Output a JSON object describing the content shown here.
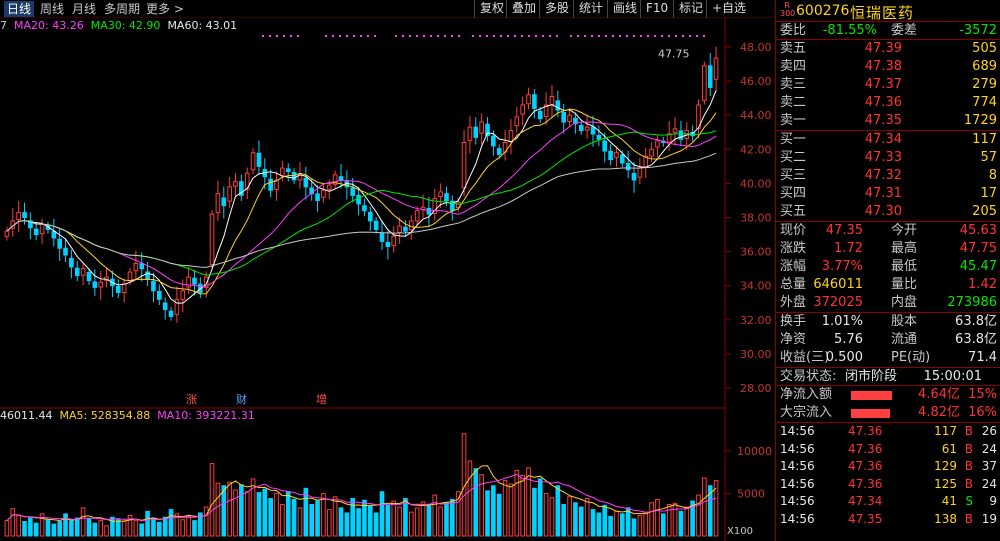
{
  "toolbar": {
    "periods": [
      "日线",
      "周线",
      "月线",
      "多周期",
      "更多 >"
    ],
    "buttons": [
      "复权",
      "叠加",
      "多股",
      "统计",
      "画线",
      "F10",
      "标记",
      "+自选"
    ]
  },
  "ma_line": {
    "cut": "7",
    "ma20": "MA20: 43.26",
    "ma30": "MA30: 42.90",
    "ma60": "MA60: 43.01"
  },
  "vol_line": {
    "vol": "46011.44",
    "ma5": "MA5: 528354.88",
    "ma10": "MA10: 393221.31"
  },
  "chart_data": {
    "type": "candlestick",
    "y_ticks": [
      "48.00",
      "46.00",
      "44.00",
      "42.00",
      "40.00",
      "38.00",
      "36.00",
      "34.00",
      "32.00",
      "30.00",
      "28.00"
    ],
    "ylim": [
      27,
      49
    ],
    "high_label": "47.75",
    "events": [
      "涨",
      "财",
      "增"
    ],
    "vol_ticks": [
      "10000",
      "5000"
    ],
    "vol_unit": "X100",
    "colors": {
      "up": "#ff3c3c",
      "down": "#00d2ff",
      "ma5": "#ffffff",
      "ma10": "#ffd21e",
      "ma20": "#ff3cff",
      "ma30": "#00e600",
      "ma60": "#c8c8c8"
    },
    "closes": [
      37.2,
      37.8,
      38.3,
      38.0,
      37.4,
      37.0,
      37.6,
      37.3,
      36.8,
      36.2,
      35.8,
      35.1,
      34.6,
      35.0,
      34.3,
      33.9,
      34.2,
      34.5,
      34.0,
      33.6,
      34.1,
      34.8,
      35.3,
      35.0,
      34.4,
      33.7,
      33.2,
      32.6,
      32.2,
      33.2,
      33.7,
      34.5,
      34.1,
      33.6,
      34.5,
      38.2,
      39.4,
      38.7,
      39.8,
      40.1,
      39.3,
      40.6,
      41.8,
      41.0,
      40.4,
      39.6,
      40.2,
      40.9,
      40.7,
      40.2,
      40.5,
      39.8,
      39.4,
      39.0,
      39.6,
      39.9,
      40.5,
      40.2,
      39.8,
      39.3,
      38.8,
      38.4,
      37.8,
      37.3,
      36.6,
      36.3,
      36.9,
      37.5,
      37.2,
      37.8,
      38.4,
      38.6,
      38.2,
      39.1,
      39.5,
      39.0,
      38.4,
      38.9,
      42.4,
      43.3,
      42.7,
      43.6,
      42.8,
      42.2,
      41.7,
      42.4,
      43.1,
      43.9,
      44.6,
      45.2,
      44.4,
      43.8,
      44.6,
      45.1,
      44.3,
      43.6,
      44.0,
      43.5,
      43.1,
      43.3,
      42.9,
      42.6,
      41.9,
      41.4,
      41.8,
      41.2,
      40.8,
      40.2,
      40.9,
      41.6,
      42.0,
      42.5,
      42.4,
      42.9,
      43.2,
      42.6,
      43.1,
      42.8,
      44.6,
      46.9,
      45.63,
      47.35
    ],
    "volumes": [
      1800,
      3200,
      2400,
      1700,
      2100,
      1500,
      2600,
      1900,
      1400,
      1700,
      2600,
      1800,
      2100,
      3300,
      2000,
      1500,
      1800,
      1200,
      2200,
      1900,
      1700,
      2400,
      1800,
      1400,
      2900,
      2100,
      1600,
      2200,
      3100,
      2600,
      1900,
      2300,
      1800,
      2700,
      3400,
      8500,
      6200,
      5900,
      6300,
      5400,
      6000,
      5200,
      6700,
      5100,
      5500,
      4400,
      5000,
      3700,
      5200,
      4300,
      3300,
      5600,
      3700,
      4100,
      5000,
      3100,
      4600,
      3300,
      2700,
      4400,
      3200,
      4200,
      3500,
      2700,
      5200,
      3600,
      4100,
      3400,
      4400,
      2800,
      3300,
      4000,
      3700,
      4800,
      3400,
      3900,
      4300,
      5200,
      12000,
      8800,
      7900,
      7200,
      5300,
      5900,
      4900,
      6500,
      6100,
      7700,
      7100,
      8000,
      5600,
      6700,
      5000,
      4500,
      5900,
      3700,
      4600,
      3900,
      3400,
      4400,
      3100,
      2700,
      3600,
      2300,
      2900,
      2600,
      3300,
      2000,
      2400,
      2800,
      3900,
      4300,
      2600,
      3700,
      3800,
      2900,
      3400,
      4100,
      4800,
      6800,
      5900,
      6500
    ]
  },
  "panel": {
    "badge": "R 300",
    "code": "600276",
    "name": "恒瑞医药",
    "weibi": {
      "label": "委比",
      "value": "-81.55%",
      "label2": "委差",
      "value2": "-3572"
    },
    "asks": [
      {
        "label": "卖五",
        "price": "47.39",
        "vol": "505"
      },
      {
        "label": "卖四",
        "price": "47.38",
        "vol": "689"
      },
      {
        "label": "卖三",
        "price": "47.37",
        "vol": "279"
      },
      {
        "label": "卖二",
        "price": "47.36",
        "vol": "774"
      },
      {
        "label": "卖一",
        "price": "47.35",
        "vol": "1729"
      }
    ],
    "bids": [
      {
        "label": "买一",
        "price": "47.34",
        "vol": "117"
      },
      {
        "label": "买二",
        "price": "47.33",
        "vol": "57"
      },
      {
        "label": "买三",
        "price": "47.32",
        "vol": "8"
      },
      {
        "label": "买四",
        "price": "47.31",
        "vol": "17"
      },
      {
        "label": "买五",
        "price": "47.30",
        "vol": "205"
      }
    ],
    "quote": [
      {
        "l1": "现价",
        "v1": "47.35",
        "c1": "red",
        "l2": "今开",
        "v2": "45.63",
        "c2": "red"
      },
      {
        "l1": "涨跌",
        "v1": "1.72",
        "c1": "red",
        "l2": "最高",
        "v2": "47.75",
        "c2": "red"
      },
      {
        "l1": "涨幅",
        "v1": "3.77%",
        "c1": "red",
        "l2": "最低",
        "v2": "45.47",
        "c2": "green"
      },
      {
        "l1": "总量",
        "v1": "646011",
        "c1": "yellow",
        "l2": "量比",
        "v2": "1.42",
        "c2": "red"
      },
      {
        "l1": "外盘",
        "v1": "372025",
        "c1": "red",
        "l2": "内盘",
        "v2": "273986",
        "c2": "green"
      }
    ],
    "fund": [
      {
        "l1": "换手",
        "v1": "1.01%",
        "l2": "股本",
        "v2": "63.8亿"
      },
      {
        "l1": "净资",
        "v1": "5.76",
        "l2": "流通",
        "v2": "63.8亿"
      },
      {
        "l1": "收益(三)",
        "v1": "0.500",
        "l2": "PE(动)",
        "v2": "71.4"
      }
    ],
    "status": {
      "label": "交易状态:",
      "value": "闭市阶段",
      "time": "15:00:01"
    },
    "flows": [
      {
        "label": "净流入额",
        "amount": "4.64亿",
        "pct": "15%",
        "bar": 0.85
      },
      {
        "label": "大宗流入",
        "amount": "4.82亿",
        "pct": "16%",
        "bar": 0.82
      }
    ],
    "ticks": [
      {
        "time": "14:56",
        "price": "47.36",
        "qty": "117",
        "side": "B",
        "n": "26"
      },
      {
        "time": "14:56",
        "price": "47.36",
        "qty": "61",
        "side": "B",
        "n": "24"
      },
      {
        "time": "14:56",
        "price": "47.36",
        "qty": "129",
        "side": "B",
        "n": "37"
      },
      {
        "time": "14:56",
        "price": "47.36",
        "qty": "125",
        "side": "B",
        "n": "24"
      },
      {
        "time": "14:56",
        "price": "47.34",
        "qty": "41",
        "side": "S",
        "n": "9"
      },
      {
        "time": "14:56",
        "price": "47.35",
        "qty": "138",
        "side": "B",
        "n": "19"
      }
    ]
  }
}
